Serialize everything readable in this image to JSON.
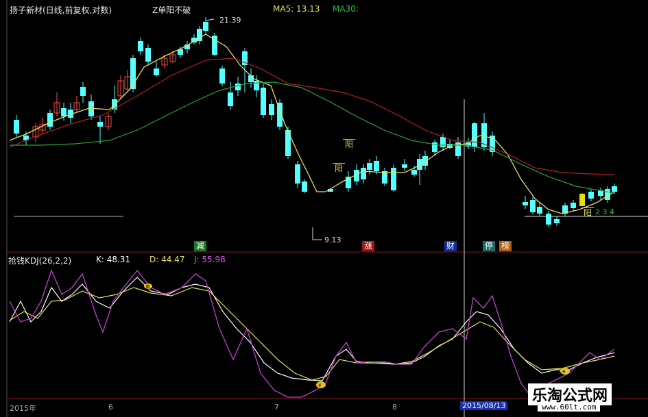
{
  "header": {
    "title": "扬子新材(日线,前复权,对数)",
    "indicator": "Z单阳不破",
    "ma5_label": "MA5: 13.13",
    "ma30_label": "MA30:"
  },
  "price_annotations": {
    "high": "21.39",
    "low": "9.13",
    "yang_badge": "阳",
    "count_tail": "2 3 4"
  },
  "event_tags": [
    "减",
    "涨",
    "财",
    "停",
    "榜"
  ],
  "kdj": {
    "title": "抢钱KDJ(26,2,2)",
    "k": "K: 48.31",
    "d": "D: 44.47",
    "j": "J: 55.98"
  },
  "time_axis": {
    "year": "2015年",
    "m6": "6",
    "m7": "7",
    "m8": "8",
    "cursor_date": "2015/08/13"
  },
  "watermark": {
    "title": "乐淘公式网",
    "url": "www.60lt.com"
  },
  "colors": {
    "up": "#ff4a4a",
    "down": "#54ffff",
    "ma_fast": "#e6e060",
    "ma_mid": "#b32020",
    "ma_slow": "#27a33a",
    "kdj_k": "#ffffff",
    "kdj_d": "#e6e060",
    "kdj_j": "#c040d0"
  },
  "icons": [
    "sell-marker-icon",
    "buy-marker-icon",
    "cursor-line"
  ]
}
